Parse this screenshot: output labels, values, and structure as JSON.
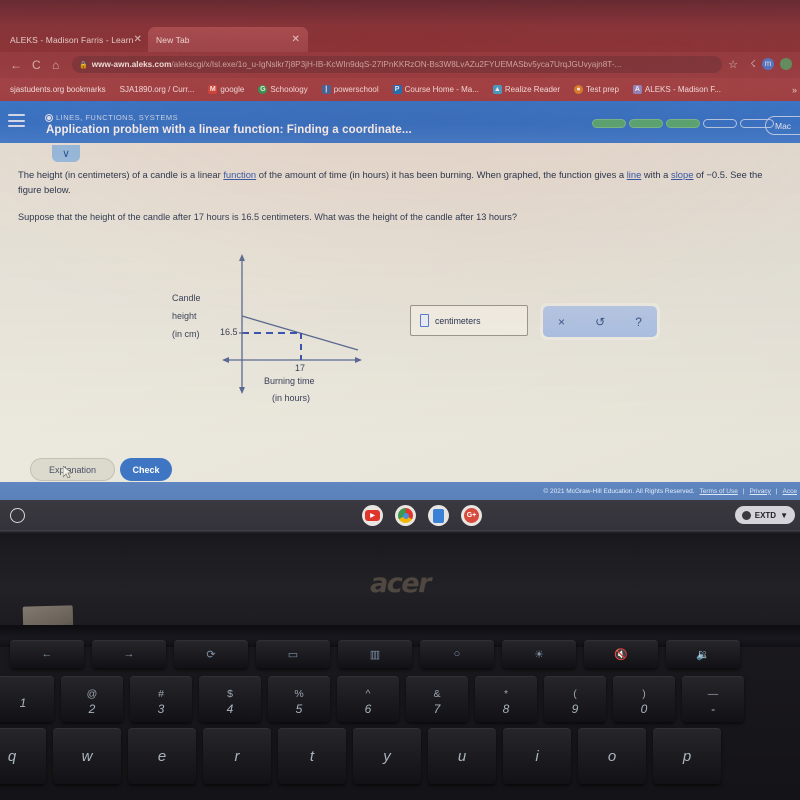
{
  "browser": {
    "tabs": [
      {
        "title": "ALEKS - Madison Farris - Learn",
        "active": false,
        "close": "✕"
      },
      {
        "title": "New Tab",
        "active": true,
        "close": "✕"
      }
    ],
    "new_tab_label": "+",
    "nav": {
      "back": "←",
      "reload": "C",
      "home": "⌂"
    },
    "omnibox": {
      "lock": "🔒",
      "host": "www-awn.aleks.com",
      "path": "/alekscgi/x/Isl.exe/1o_u-IgNslkr7j8P3jH-IB-KcWIn9dqS-27IPnKKRzON-Bs3W8LvAZu2FYUEMASbv5yca7UrqJGUvyajn8T-..."
    },
    "star": "☆",
    "extension_badge": "m",
    "bookmarks": [
      {
        "label": "sjastudents.org bookmarks",
        "icon": "",
        "color": "transparent"
      },
      {
        "label": "SJA1890.org / Curr...",
        "icon": "",
        "color": "transparent"
      },
      {
        "label": "google",
        "icon": "M",
        "color": "#d94b3f"
      },
      {
        "label": "Schoology",
        "icon": "G",
        "color": "#3aa35b"
      },
      {
        "label": "powerschool",
        "icon": "|",
        "color": "#4a6fa8"
      },
      {
        "label": "Course Home - Ma...",
        "icon": "P",
        "color": "#2a7ac4"
      },
      {
        "label": "Realize Reader",
        "icon": "▲",
        "color": "#4fa8d8"
      },
      {
        "label": "Test prep",
        "icon": "●",
        "color": "#e08a2e"
      },
      {
        "label": "ALEKS - Madison F...",
        "icon": "A",
        "color": "transparent"
      }
    ],
    "bookmarks_overflow": "»"
  },
  "aleks": {
    "kicker": "LINES, FUNCTIONS, SYSTEMS",
    "title": "Application problem with a linear function: Finding a coordinate...",
    "progress": {
      "total": 5,
      "filled": 3
    },
    "account_button": "Mac",
    "collapse_chevron": "∨",
    "problem": {
      "paragraph1_a": "The height (in centimeters) of a candle is a linear ",
      "link_function": "function",
      "paragraph1_b": " of the amount of time (in hours) it has been burning. When graphed, the function gives a ",
      "link_line": "line",
      "paragraph1_c": " with a ",
      "link_slope": "slope",
      "paragraph1_d": " of −0.5. See the figure below.",
      "paragraph2": "Suppose that the height of the candle after 17 hours is 16.5 centimeters. What was the height of the candle after 13 hours?"
    },
    "figure": {
      "y_label_line1": "Candle",
      "y_label_line2": "height",
      "y_label_line3": "(in cm)",
      "y_tick": "16.5",
      "x_tick": "17",
      "x_label_line1": "Burning time",
      "x_label_line2": "(in hours)"
    },
    "answer": {
      "placeholder_box": "",
      "unit": "centimeters"
    },
    "tools": [
      {
        "name": "clear",
        "glyph": "×"
      },
      {
        "name": "undo",
        "glyph": "↺"
      },
      {
        "name": "help",
        "glyph": "?"
      }
    ],
    "buttons": {
      "explanation": "Explanation",
      "check": "Check"
    },
    "footer": {
      "copyright": "© 2021 McGraw-Hill Education. All Rights Reserved.",
      "links": [
        "Terms of Use",
        "Privacy",
        "Acce"
      ]
    }
  },
  "chart_data": {
    "type": "line",
    "title": "",
    "xlabel": "Burning time (in hours)",
    "ylabel": "Candle height (in cm)",
    "slope": -0.5,
    "points": [
      {
        "x": 17,
        "y": 16.5
      }
    ],
    "x_ticks": [
      "17"
    ],
    "y_ticks": [
      "16.5"
    ],
    "grid": false,
    "legend": "none",
    "annotations": [
      "dashed horizontal line at y=16.5",
      "dashed vertical line at x=17"
    ]
  },
  "shelf": {
    "launcher": "○",
    "icons": [
      {
        "name": "youtube",
        "glyph": "▶",
        "color": "#e0352b"
      },
      {
        "name": "chrome",
        "glyph": "◉",
        "color": "#f2b705"
      },
      {
        "name": "docs",
        "glyph": "☰",
        "color": "#3b82d6"
      },
      {
        "name": "google-plus",
        "glyph": "G+",
        "color": "#d64b3c"
      }
    ],
    "tray_label": "EXTD",
    "tray_wifi": "▼"
  },
  "laptop": {
    "brand": "acer",
    "function_row": [
      {
        "name": "back-key",
        "glyph": "←"
      },
      {
        "name": "forward-key",
        "glyph": "→"
      },
      {
        "name": "reload-key",
        "glyph": "⟳"
      },
      {
        "name": "fullscreen-key",
        "glyph": "▭"
      },
      {
        "name": "overview-key",
        "glyph": "▥"
      },
      {
        "name": "brightness-down-key",
        "glyph": "○"
      },
      {
        "name": "brightness-up-key",
        "glyph": "☀"
      },
      {
        "name": "mute-key",
        "glyph": "🔇"
      },
      {
        "name": "volume-down-key",
        "glyph": "🔉"
      }
    ],
    "number_row": [
      {
        "upper": "",
        "lower": "1"
      },
      {
        "upper": "@",
        "lower": "2"
      },
      {
        "upper": "#",
        "lower": "3"
      },
      {
        "upper": "$",
        "lower": "4"
      },
      {
        "upper": "%",
        "lower": "5"
      },
      {
        "upper": "^",
        "lower": "6"
      },
      {
        "upper": "&",
        "lower": "7"
      },
      {
        "upper": "*",
        "lower": "8"
      },
      {
        "upper": "(",
        "lower": "9"
      },
      {
        "upper": ")",
        "lower": "0"
      },
      {
        "upper": "—",
        "lower": "-"
      }
    ],
    "letter_row": [
      "q",
      "w",
      "e",
      "r",
      "t",
      "y",
      "u",
      "i",
      "o",
      "p"
    ]
  }
}
